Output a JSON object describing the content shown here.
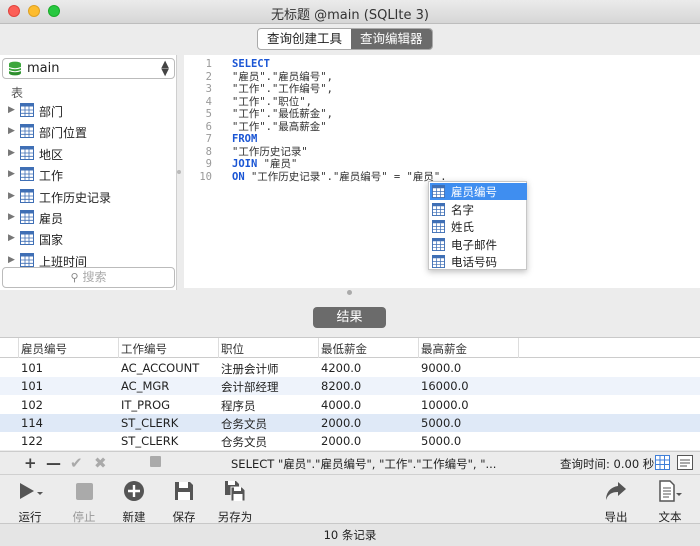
{
  "window": {
    "title": "无标题 @main (SQLIte 3)"
  },
  "tabs": [
    {
      "label": "查询创建工具"
    },
    {
      "label": "查询编辑器"
    }
  ],
  "sidebar": {
    "database": "main",
    "section_label": "表",
    "tables": [
      {
        "label": "部门"
      },
      {
        "label": "部门位置"
      },
      {
        "label": "地区"
      },
      {
        "label": "工作"
      },
      {
        "label": "工作历史记录"
      },
      {
        "label": "雇员"
      },
      {
        "label": "国家"
      },
      {
        "label": "上班时间"
      }
    ],
    "search_placeholder": "搜索"
  },
  "editor": {
    "line_numbers": [
      "1",
      "2",
      "3",
      "4",
      "5",
      "6",
      "7",
      "8",
      "9",
      "10"
    ],
    "lines": [
      {
        "kw": "SELECT",
        "text": ""
      },
      {
        "kw": "",
        "text": "\"雇员\".\"雇员编号\","
      },
      {
        "kw": "",
        "text": "\"工作\".\"工作编号\","
      },
      {
        "kw": "",
        "text": "\"工作\".\"职位\","
      },
      {
        "kw": "",
        "text": "\"工作\".\"最低薪金\","
      },
      {
        "kw": "",
        "text": "\"工作\".\"最高薪金\""
      },
      {
        "kw": "FROM",
        "text": ""
      },
      {
        "kw": "",
        "text": "\"工作历史记录\""
      },
      {
        "kw": "JOIN",
        "text": " \"雇员\""
      },
      {
        "kw": "ON",
        "text": " \"工作历史记录\".\"雇员编号\" = \"雇员\"."
      }
    ],
    "autocomplete": [
      {
        "label": "雇员编号"
      },
      {
        "label": "名字"
      },
      {
        "label": "姓氏"
      },
      {
        "label": "电子邮件"
      },
      {
        "label": "电话号码"
      }
    ]
  },
  "results_button": "结果",
  "grid": {
    "columns": [
      "雇员编号",
      "工作编号",
      "职位",
      "最低薪金",
      "最高薪金"
    ],
    "rows": [
      [
        "101",
        "AC_ACCOUNT",
        "注册会计师",
        "4200.0",
        "9000.0"
      ],
      [
        "101",
        "AC_MGR",
        "会计部经理",
        "8200.0",
        "16000.0"
      ],
      [
        "102",
        "IT_PROG",
        "程序员",
        "4000.0",
        "10000.0"
      ],
      [
        "114",
        "ST_CLERK",
        "仓务文员",
        "2000.0",
        "5000.0"
      ],
      [
        "122",
        "ST_CLERK",
        "仓务文员",
        "2000.0",
        "5000.0"
      ]
    ]
  },
  "grid_toolbar": {
    "sql_preview": "SELECT \"雇员\".\"雇员编号\", \"工作\".\"工作编号\", \"...",
    "query_time": "查询时间: 0.00 秒"
  },
  "toolbar": {
    "run": "运行",
    "stop": "停止",
    "new": "新建",
    "save": "保存",
    "save_as": "另存为",
    "export": "导出",
    "text": "文本"
  },
  "status": "10 条记录",
  "colors": {
    "keyword": "#1a55d4",
    "selection": "#3f8ef0",
    "segment_active": "#6b6b6b"
  }
}
